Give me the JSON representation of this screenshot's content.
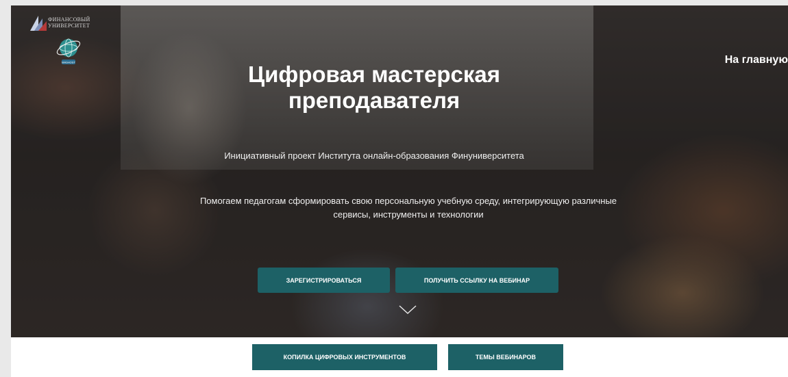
{
  "logo": {
    "line1": "ФИНАНСОВЫЙ",
    "line2": "УНИВЕРСИТЕТ",
    "globe_label": "MASHOST"
  },
  "nav": {
    "home_label": "На главную"
  },
  "hero": {
    "title": "Цифровая мастерская преподавателя",
    "subtitle": "Инициативный проект Института онлайн-образования Финуниверситета",
    "description": "Помогаем педагогам сформировать свою персональную учебную среду, интегрирующую различные сервисы, инструменты и технологии",
    "register_button": "ЗАРЕГИСТРИРОВАТЬСЯ",
    "webinar_link_button": "ПОЛУЧИТЬ ССЫЛКУ НА ВЕБИНАР",
    "scroll_icon": "chevron-down-icon"
  },
  "bottom_nav": {
    "tools_button": "КОПИЛКА ЦИФРОВЫХ ИНСТРУМЕНТОВ",
    "topics_button": "ТЕМЫ ВЕБИНАРОВ"
  },
  "colors": {
    "accent": "#1d6166",
    "text_on_dark": "#ffffff"
  }
}
